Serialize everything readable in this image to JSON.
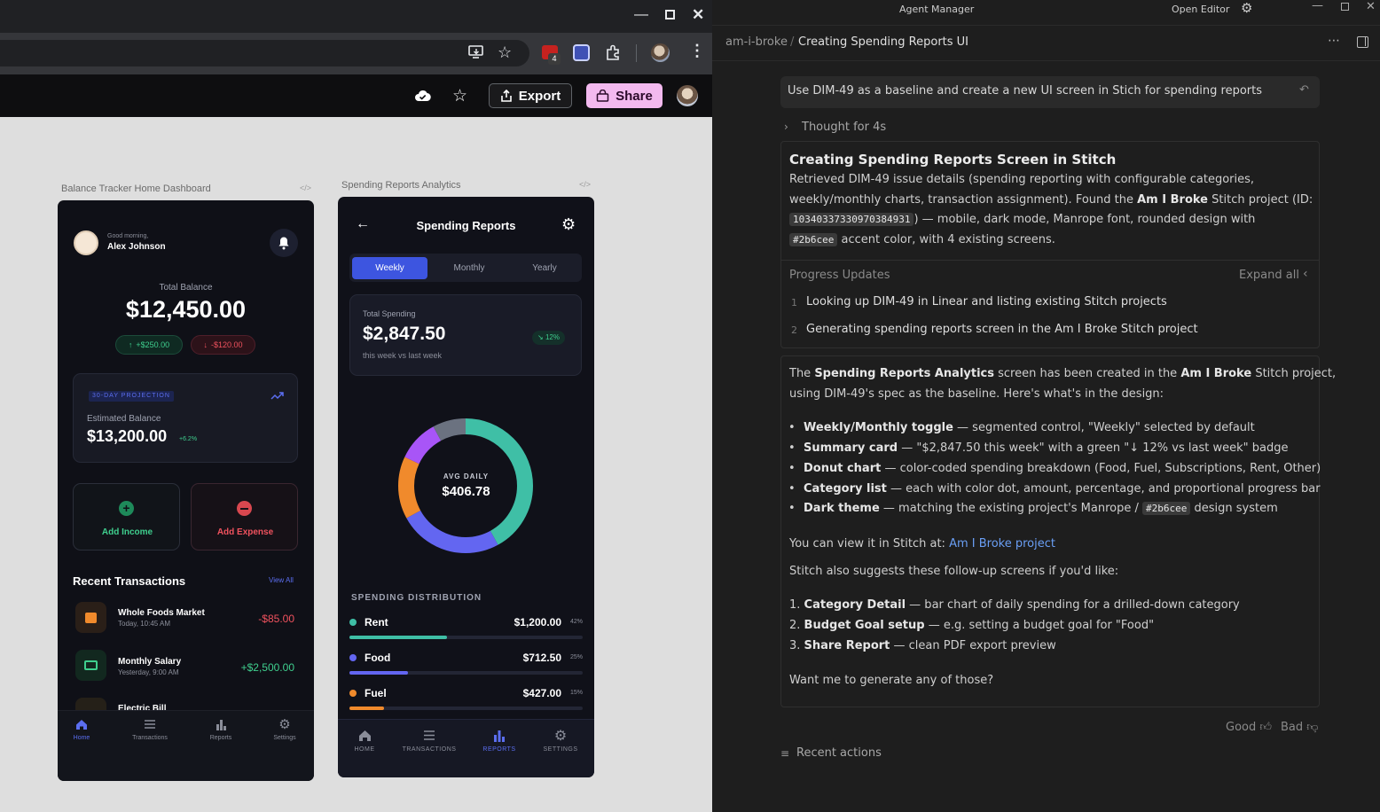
{
  "browser": {
    "ext_badge": "4",
    "export_label": "Export",
    "share_label": "Share"
  },
  "frames": {
    "home_label": "Balance Tracker Home Dashboard",
    "reports_label": "Spending Reports Analytics",
    "code_glyph": "</>"
  },
  "home": {
    "greeting": "Good morning,",
    "user_name": "Alex Johnson",
    "total_label": "Total Balance",
    "total_value": "$12,450.00",
    "up_pill": "+$250.00",
    "down_pill": "-$120.00",
    "projection_tag": "30-DAY PROJECTION",
    "estimated_label": "Estimated Balance",
    "estimated_value": "$13,200.00",
    "estimated_change": "+6.2%",
    "add_income": "Add Income",
    "add_expense": "Add Expense",
    "recent_title": "Recent Transactions",
    "view_all": "View All",
    "transactions": [
      {
        "name": "Whole Foods Market",
        "time": "Today, 10:45 AM",
        "amount": "-$85.00"
      },
      {
        "name": "Monthly Salary",
        "time": "Yesterday, 9:00 AM",
        "amount": "+$2,500.00"
      },
      {
        "name": "Electric Bill",
        "time": "",
        "amount": ""
      }
    ],
    "nav": [
      "Home",
      "Transactions",
      "Reports",
      "Settings"
    ]
  },
  "reports": {
    "title": "Spending Reports",
    "tabs": [
      "Weekly",
      "Monthly",
      "Yearly"
    ],
    "total_label": "Total Spending",
    "total_value": "$2,847.50",
    "compare": "this week vs last week",
    "badge": "12%",
    "avg_label": "AVG DAILY",
    "avg_value": "$406.78",
    "dist_title": "SPENDING DISTRIBUTION",
    "categories": [
      {
        "name": "Rent",
        "amount": "$1,200.00",
        "pct": "42%",
        "color": "#2b6cee",
        "fill": 0.42
      },
      {
        "name": "Food",
        "amount": "$712.50",
        "pct": "25%",
        "color": "#6366f1",
        "fill": 0.25
      },
      {
        "name": "Fuel",
        "amount": "$427.00",
        "pct": "15%",
        "color": "#f08a2c",
        "fill": 0.15
      }
    ],
    "nav": [
      "HOME",
      "TRANSACTIONS",
      "REPORTS",
      "SETTINGS"
    ],
    "colors": {
      "teal": "#3fbfa6",
      "indigo": "#6366f1",
      "orange": "#f08a2c",
      "purple": "#a855f7",
      "gray": "#6b7280",
      "accent": "#2b6cee"
    }
  },
  "agent": {
    "title": "Agent Manager",
    "open_editor": "Open Editor",
    "breadcrumb_project": "am-i-broke",
    "breadcrumb_sep": "/",
    "breadcrumb_title": "Creating Spending Reports UI",
    "prompt": "Use DIM-49 as a baseline and create a new UI screen in Stich for spending reports",
    "thought": "Thought for 4s",
    "card_title": "Creating Spending Reports Screen in Stitch",
    "card_l1": "Retrieved DIM-49 issue details (spending reporting with configurable categories,",
    "card_l2a": "weekly/monthly charts, transaction assignment). Found the ",
    "card_l2b": "Am I Broke",
    "card_l2c": " Stitch project (ID:",
    "card_code1": "10340337330970384931",
    "card_l3": ") — mobile, dark mode, Manrope font, rounded design with",
    "card_code2": "#2b6cee",
    "card_l4": " accent color, with 4 existing screens.",
    "progress_label": "Progress Updates",
    "expand_all": "Expand all",
    "steps": [
      {
        "n": "1",
        "text": "Looking up DIM-49 in Linear and listing existing Stitch projects"
      },
      {
        "n": "2",
        "text": "Generating spending reports screen in the Am I Broke Stitch project"
      }
    ],
    "resp_l1a": "The ",
    "resp_l1b": "Spending Reports Analytics",
    "resp_l1c": " screen has been created in the ",
    "resp_l1d": "Am I Broke",
    "resp_l1e": " Stitch project,",
    "resp_l2": "using DIM-49's spec as the baseline. Here's what's in the design:",
    "bullets": [
      {
        "b": "Weekly/Monthly toggle",
        "t": " — segmented control, \"Weekly\" selected by default"
      },
      {
        "b": "Summary card",
        "t": " — \"$2,847.50 this week\" with a green \"↓ 12% vs last week\" badge"
      },
      {
        "b": "Donut chart",
        "t": " — color-coded spending breakdown (Food, Fuel, Subscriptions, Rent, Other)"
      },
      {
        "b": "Category list",
        "t": " — each with color dot, amount, percentage, and proportional progress bar"
      },
      {
        "b": "Dark theme",
        "t": " — matching the existing project's Manrope / "
      }
    ],
    "dark_code": "#2b6cee",
    "dark_tail": " design system",
    "view_text": "You can view it in Stitch at: ",
    "view_link": "Am I Broke project",
    "suggest": "Stitch also suggests these follow-up screens if you'd like:",
    "followups": [
      {
        "n": "1.",
        "b": "Category Detail",
        "t": " — bar chart of daily spending for a drilled-down category"
      },
      {
        "n": "2.",
        "b": "Budget Goal setup",
        "t": " — e.g. setting a budget goal for \"Food\""
      },
      {
        "n": "3.",
        "b": "Share Report",
        "t": " — clean PDF export preview"
      }
    ],
    "question": "Want me to generate any of those?",
    "good": "Good",
    "bad": "Bad",
    "recent_actions": "Recent actions"
  }
}
